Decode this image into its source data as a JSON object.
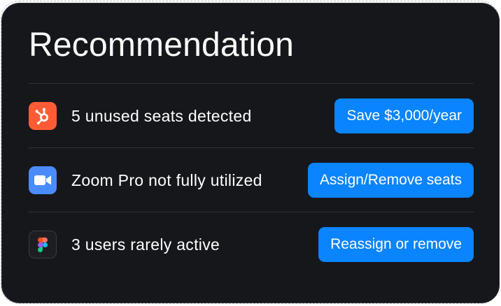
{
  "card": {
    "title": "Recommendation"
  },
  "recommendations": [
    {
      "app_icon": "hubspot-icon",
      "text": "5 unused seats detected",
      "action_label": "Save $3,000/year"
    },
    {
      "app_icon": "zoom-icon",
      "text": "Zoom Pro not fully utilized",
      "action_label": "Assign/Remove seats"
    },
    {
      "app_icon": "figma-icon",
      "text": "3 users rarely active",
      "action_label": "Reassign or remove"
    }
  ],
  "colors": {
    "card_background": "#16171b",
    "button": "#0a84ff",
    "hubspot": "#ff5c35",
    "zoom": "#4a8cff",
    "divider": "#303136"
  }
}
